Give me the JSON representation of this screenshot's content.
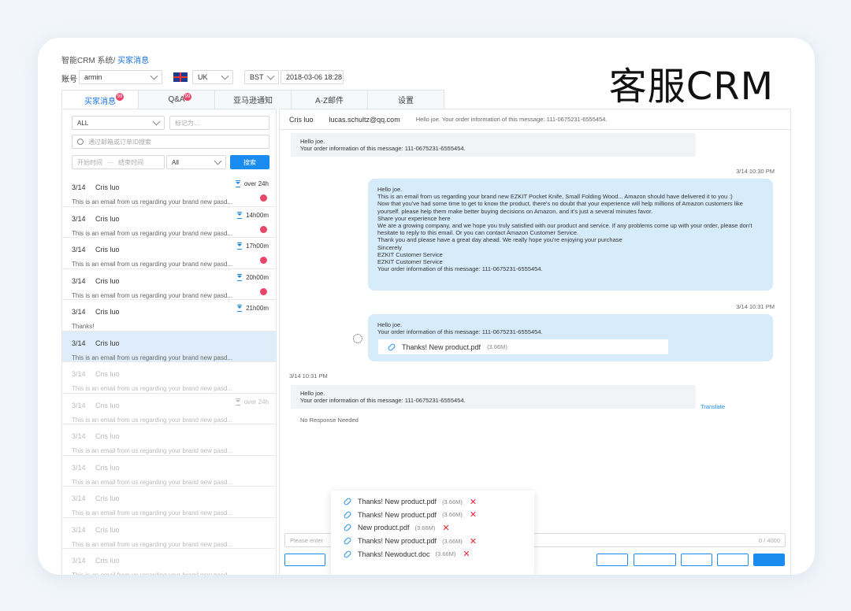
{
  "brand_title": "客服CRM",
  "breadcrumb": {
    "root": "智能CRM 系统/",
    "current": "买家消息"
  },
  "account": {
    "label": "账号",
    "value": "armin"
  },
  "market": {
    "value": "UK"
  },
  "timezone": {
    "zone": "BST",
    "datetime": "2018-03-06 18:28"
  },
  "tabs": [
    {
      "label": "买家消息",
      "badge": "99",
      "active": true
    },
    {
      "label": "Q&A",
      "badge": "99",
      "active": false
    },
    {
      "label": "亚马逊通知",
      "badge": "",
      "active": false
    },
    {
      "label": "A-Z邮件",
      "badge": "",
      "active": false
    },
    {
      "label": "设置",
      "badge": "",
      "active": false
    }
  ],
  "filters": {
    "status": "ALL",
    "mark_placeholder": "标记为...",
    "search_placeholder": "通过邮箱或订单ID搜索",
    "start_placeholder": "开始时间",
    "end_placeholder": "结束时间",
    "range": "All",
    "search_button": "搜索"
  },
  "conversations": [
    {
      "date": "3/14",
      "name": "Cris luo",
      "timer": "over 24h",
      "preview": "This is an email from us regarding your brand new pasd...",
      "unread": true,
      "faded": false,
      "selected": false
    },
    {
      "date": "3/14",
      "name": "Cris luo",
      "timer": "14h00m",
      "preview": "This is an email from us regarding your brand new pasd...",
      "unread": true,
      "faded": false,
      "selected": false
    },
    {
      "date": "3/14",
      "name": "Cris luo",
      "timer": "17h00m",
      "preview": "This is an email from us regarding your brand new pasd...",
      "unread": true,
      "faded": false,
      "selected": false
    },
    {
      "date": "3/14",
      "name": "Cris luo",
      "timer": "20h00m",
      "preview": "This is an email from us regarding your brand new pasd...",
      "unread": true,
      "faded": false,
      "selected": false
    },
    {
      "date": "3/14",
      "name": "Cris luo",
      "timer": "21h00m",
      "preview": "Thanks!",
      "unread": false,
      "faded": false,
      "selected": false
    },
    {
      "date": "3/14",
      "name": "Cris luo",
      "timer": "",
      "preview": "This is an email from us regarding your brand new pasd...",
      "unread": false,
      "faded": false,
      "selected": true
    },
    {
      "date": "3/14",
      "name": "Cris luo",
      "timer": "",
      "preview": "This is an email from us regarding your brand new pasd...",
      "unread": false,
      "faded": true,
      "selected": false
    },
    {
      "date": "3/14",
      "name": "Cris luo",
      "timer": "over 24h",
      "preview": "This is an email from us regarding your brand new pasd...",
      "unread": false,
      "faded": true,
      "selected": false
    },
    {
      "date": "3/14",
      "name": "Cris luo",
      "timer": "",
      "preview": "This is an email from us regarding your brand new pasd...",
      "unread": false,
      "faded": true,
      "selected": false
    },
    {
      "date": "3/14",
      "name": "Cris luo",
      "timer": "",
      "preview": "This is an email from us regarding your brand new pasd...",
      "unread": false,
      "faded": true,
      "selected": false
    },
    {
      "date": "3/14",
      "name": "Cris luo",
      "timer": "",
      "preview": "This is an email from us regarding your brand new pasd...",
      "unread": false,
      "faded": true,
      "selected": false
    },
    {
      "date": "3/14",
      "name": "Cris luo",
      "timer": "",
      "preview": "This is an email from us regarding your brand new pasd...",
      "unread": false,
      "faded": true,
      "selected": false
    },
    {
      "date": "3/14",
      "name": "Cris luo",
      "timer": "",
      "preview": "This is an email from us regarding your brand new pasd...",
      "unread": false,
      "faded": true,
      "selected": false
    }
  ],
  "thread_header": {
    "name": "Cris luo",
    "email": "lucas.schultz@qq.com",
    "subject": "Hello joe. Your order information of this message: 111-0675231-6555454."
  },
  "messages": {
    "m1": "Hello joe.\nYour order information of this message: 111-0675231-6555454.",
    "ts1": "3/14 10:30 PM",
    "m2": "Hello joe.\nThis is an email from us regarding your brand new EZKIT Pocket Knife, Small Folding Wood... Amazon should have delivered it to you :)\nNow that you've had some time to get to know the product, there's no doubt that your experience will help millions of Amazon customers like yourself. please help them make better buying decisions on Amazon. and it's just a several minutes favor.\nShare your experience here\nWe are a growing company, and we hope you truly satisfied with our product and service. If any problems come up with your order, please don't hesitate to reply to this email. Or you can contact Amazon Customer Service.\nThank you and please have a great day ahead. We really hope you're enjoying your purchase\nSincerely\nEZKIT Customer Service\nEZKIT Customer Service\nYour order information of this message: 111-0675231-6555454.",
    "ts2": "3/14 10:31 PM",
    "m3": "Hello joe.\nYour order information of this message: 111-0675231-6555454.",
    "m3_file": {
      "name": "Thanks! New product.pdf",
      "size": "(3.66M)"
    },
    "ts3": "3/14 10:31 PM",
    "m4": "Hello joe.\nYour order information of this message: 111-0675231-6555454.",
    "translate": "Translate",
    "no_response": "No Response Needed"
  },
  "attachments": [
    {
      "name": "Thanks! New product.pdf",
      "size": "(3.66M)"
    },
    {
      "name": "Thanks! New product.pdf",
      "size": "(3.66M)"
    },
    {
      "name": "New product.pdf",
      "size": "(3.66M)"
    },
    {
      "name": "Thanks! New product.pdf",
      "size": "(3.66M)"
    },
    {
      "name": "Thanks! Newoduct.doc",
      "size": "(3.66M)"
    }
  ],
  "composer": {
    "placeholder": "Please enter",
    "counter": "0 / 4000"
  }
}
